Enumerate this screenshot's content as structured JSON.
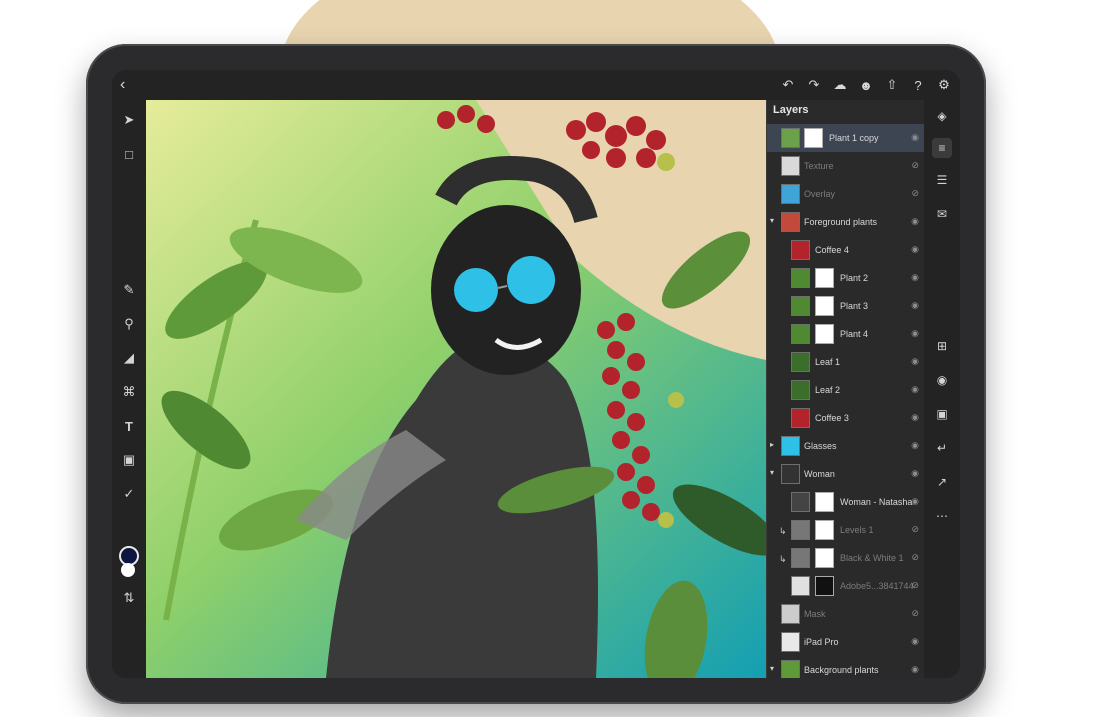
{
  "topbar": {
    "back_icon": "chevron-left-icon",
    "actions": [
      "undo-icon",
      "redo-icon",
      "cloud-icon",
      "user-icon",
      "share-icon",
      "help-icon",
      "settings-icon"
    ]
  },
  "toolbar": {
    "tools": [
      "move-icon",
      "transform-icon",
      "brush-icon",
      "quick-select-icon",
      "fill-icon",
      "crop-icon",
      "type-icon",
      "image-icon",
      "eyedropper-icon",
      "swap-icon"
    ],
    "foreground_color": "#0d1540",
    "background_color": "#ffffff"
  },
  "layers": {
    "title": "Layers",
    "items": [
      {
        "name": "Plant 1 copy",
        "selected": true,
        "visible": true
      },
      {
        "name": "Texture",
        "visible": false
      },
      {
        "name": "Overlay",
        "visible": false
      },
      {
        "name": "Foreground plants",
        "group": true,
        "visible": true
      },
      {
        "name": "Coffee 4",
        "visible": true
      },
      {
        "name": "Plant 2",
        "visible": true
      },
      {
        "name": "Plant 3",
        "visible": true
      },
      {
        "name": "Plant 4",
        "visible": true
      },
      {
        "name": "Leaf 1",
        "visible": true
      },
      {
        "name": "Leaf 2",
        "visible": true
      },
      {
        "name": "Coffee 3",
        "visible": true
      },
      {
        "name": "Glasses",
        "group": true,
        "visible": true
      },
      {
        "name": "Woman",
        "group": true,
        "visible": true
      },
      {
        "name": "Woman - Natasha",
        "visible": true
      },
      {
        "name": "Levels 1",
        "visible": false
      },
      {
        "name": "Black & White 1",
        "visible": false
      },
      {
        "name": "Adobe5...3841744",
        "visible": false
      },
      {
        "name": "Mask",
        "visible": false
      },
      {
        "name": "iPad Pro",
        "visible": true
      },
      {
        "name": "Background plants",
        "group": true,
        "visible": true
      }
    ]
  },
  "rightbar": {
    "icons": [
      "layers-icon",
      "layer-properties-icon",
      "adjustments-icon",
      "comments-icon",
      "add-layer-icon",
      "visibility-icon",
      "mask-icon",
      "clip-icon",
      "fx-icon",
      "more-icon"
    ]
  },
  "colors": {
    "accent_selection": "#3d4552",
    "panel_bg": "#2a2a2a",
    "canvas_beige": "#e8d5b0",
    "canvas_teal": "#1aa6b0",
    "berry_red": "#b3232c"
  }
}
